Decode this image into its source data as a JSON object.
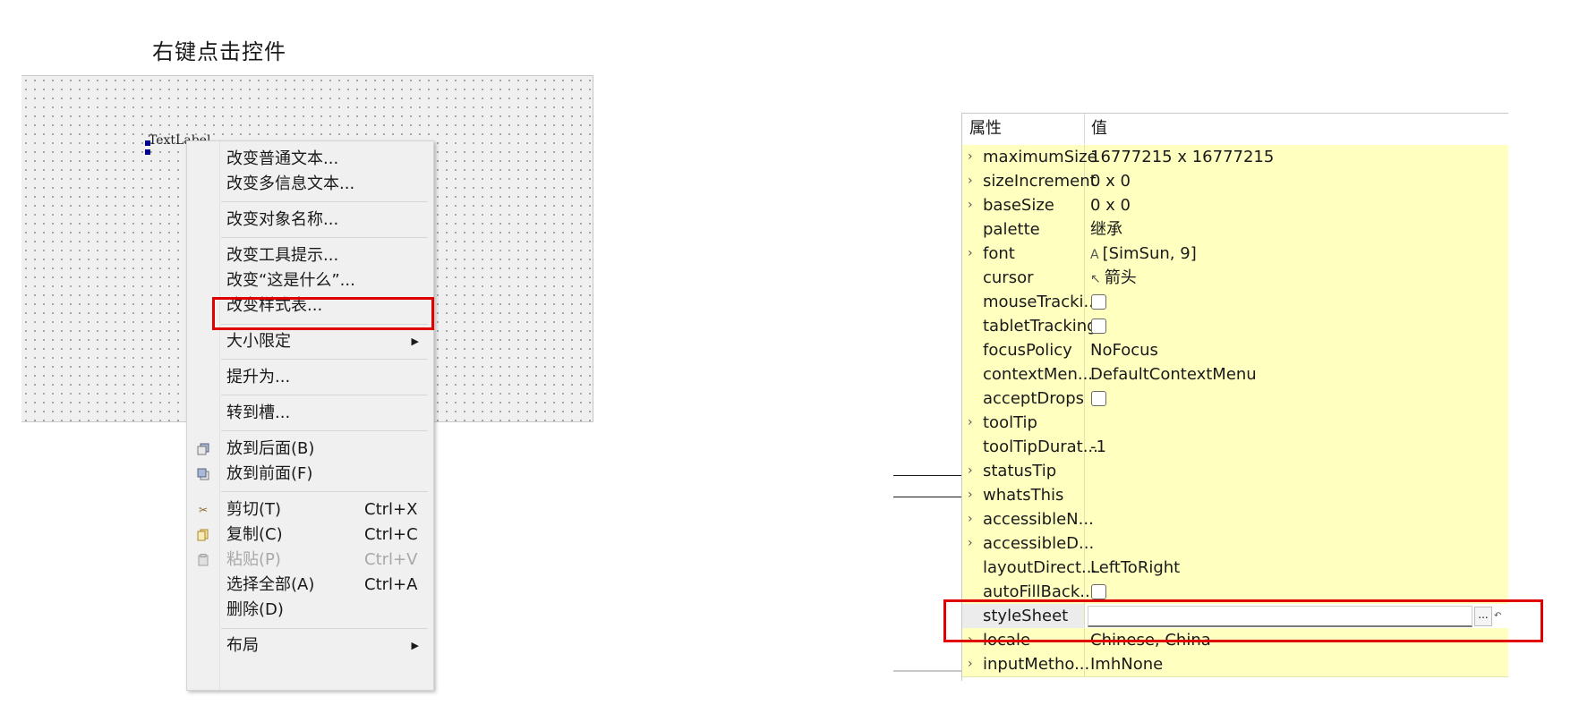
{
  "caption": "右键点击控件",
  "form": {
    "label_text": "TextLabel"
  },
  "context_menu": {
    "items": [
      {
        "label": "改变普通文本..."
      },
      {
        "label": "改变多信息文本..."
      },
      {
        "label": "改变对象名称..."
      },
      {
        "label": "改变工具提示..."
      },
      {
        "label": "改变“这是什么”..."
      },
      {
        "label": "改变样式表..."
      },
      {
        "label": "大小限定",
        "submenu": true
      },
      {
        "label": "提升为..."
      },
      {
        "label": "转到槽..."
      },
      {
        "label": "放到后面(B)",
        "icon": "send-to-back-icon"
      },
      {
        "label": "放到前面(F)",
        "icon": "bring-to-front-icon"
      },
      {
        "label": "剪切(T)",
        "shortcut": "Ctrl+X",
        "icon": "scissors-icon"
      },
      {
        "label": "复制(C)",
        "shortcut": "Ctrl+C",
        "icon": "copy-icon"
      },
      {
        "label": "粘贴(P)",
        "shortcut": "Ctrl+V",
        "icon": "paste-icon",
        "disabled": true
      },
      {
        "label": "选择全部(A)",
        "shortcut": "Ctrl+A"
      },
      {
        "label": "删除(D)"
      },
      {
        "label": "布局",
        "submenu": true
      }
    ],
    "highlighted": "改变样式表..."
  },
  "property_editor": {
    "header": {
      "property": "属性",
      "value": "值"
    },
    "rows": [
      {
        "name": "maximumSize",
        "value": "16777215 x 16777215",
        "expandable": true
      },
      {
        "name": "sizeIncrement",
        "value": "0 x 0",
        "expandable": true
      },
      {
        "name": "baseSize",
        "value": "0 x 0",
        "expandable": true
      },
      {
        "name": "palette",
        "value": "继承"
      },
      {
        "name": "font",
        "value": "[SimSun, 9]",
        "expandable": true,
        "icon": "font-icon"
      },
      {
        "name": "cursor",
        "value": "箭头",
        "icon": "cursor-arrow-icon"
      },
      {
        "name": "mouseTracki...",
        "checkbox": true
      },
      {
        "name": "tabletTracking",
        "checkbox": true
      },
      {
        "name": "focusPolicy",
        "value": "NoFocus"
      },
      {
        "name": "contextMen...",
        "value": "DefaultContextMenu"
      },
      {
        "name": "acceptDrops",
        "checkbox": true
      },
      {
        "name": "toolTip",
        "value": "",
        "expandable": true
      },
      {
        "name": "toolTipDurat...",
        "value": "-1"
      },
      {
        "name": "statusTip",
        "value": "",
        "expandable": true
      },
      {
        "name": "whatsThis",
        "value": "",
        "expandable": true
      },
      {
        "name": "accessibleN...",
        "value": "",
        "expandable": true
      },
      {
        "name": "accessibleD...",
        "value": "",
        "expandable": true
      },
      {
        "name": "layoutDirect...",
        "value": "LeftToRight"
      },
      {
        "name": "autoFillBack...",
        "checkbox": true
      },
      {
        "name": "styleSheet",
        "value": "",
        "editor": true,
        "button": "...",
        "reset": "↶"
      },
      {
        "name": "locale",
        "value": "Chinese, China",
        "expandable": true
      },
      {
        "name": "inputMetho...",
        "value": "ImhNone",
        "expandable": true
      }
    ],
    "highlighted": "styleSheet"
  },
  "colors": {
    "highlight": "#e00000",
    "row_bg": "#ffffc0",
    "selection_handle": "#00008b"
  }
}
